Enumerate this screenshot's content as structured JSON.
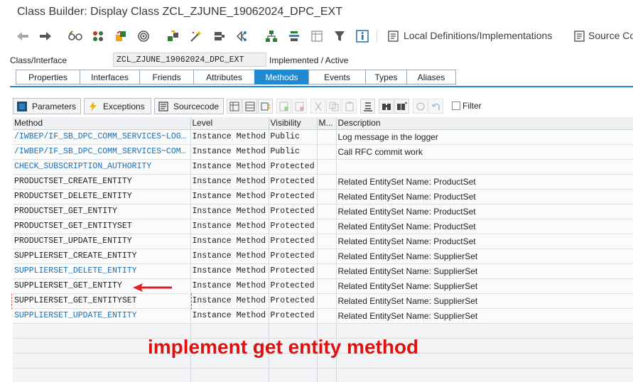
{
  "window": {
    "title": "Class Builder: Display Class ZCL_ZJUNE_19062024_DPC_EXT"
  },
  "toolbar": {
    "local_definitions_label": "Local Definitions/Implementations",
    "source_code_label": "Source Co"
  },
  "header": {
    "class_label": "Class/Interface",
    "class_value": "ZCL_ZJUNE_19062024_DPC_EXT",
    "status": "Implemented / Active"
  },
  "tabs": [
    "Properties",
    "Interfaces",
    "Friends",
    "Attributes",
    "Methods",
    "Events",
    "Types",
    "Aliases"
  ],
  "active_tab": "Methods",
  "method_toolbar": {
    "parameters_label": "Parameters",
    "exceptions_label": "Exceptions",
    "sourcecode_label": "Sourcecode",
    "filter_label": "Filter"
  },
  "columns": [
    "Method",
    "Level",
    "Visibility",
    "M...",
    "Description"
  ],
  "rows": [
    {
      "method": "/IWBEP/IF_SB_DPC_COMM_SERVICES~LOG_MESSAGE",
      "level": "Instance Method",
      "visibility": "Public",
      "m": "",
      "description": "Log message in the logger",
      "style": "link"
    },
    {
      "method": "/IWBEP/IF_SB_DPC_COMM_SERVICES~COMMIT_WORK",
      "level": "Instance Method",
      "visibility": "Public",
      "m": "",
      "description": "Call RFC commit work",
      "style": "link"
    },
    {
      "method": "CHECK_SUBSCRIPTION_AUTHORITY",
      "level": "Instance Method",
      "visibility": "Protected",
      "m": "",
      "description": "",
      "style": "link"
    },
    {
      "method": "PRODUCTSET_CREATE_ENTITY",
      "level": "Instance Method",
      "visibility": "Protected",
      "m": "",
      "description": "Related EntitySet Name: ProductSet",
      "style": "plain"
    },
    {
      "method": "PRODUCTSET_DELETE_ENTITY",
      "level": "Instance Method",
      "visibility": "Protected",
      "m": "",
      "description": "Related EntitySet Name: ProductSet",
      "style": "plain"
    },
    {
      "method": "PRODUCTSET_GET_ENTITY",
      "level": "Instance Method",
      "visibility": "Protected",
      "m": "",
      "description": "Related EntitySet Name: ProductSet",
      "style": "plain"
    },
    {
      "method": "PRODUCTSET_GET_ENTITYSET",
      "level": "Instance Method",
      "visibility": "Protected",
      "m": "",
      "description": "Related EntitySet Name: ProductSet",
      "style": "plain"
    },
    {
      "method": "PRODUCTSET_UPDATE_ENTITY",
      "level": "Instance Method",
      "visibility": "Protected",
      "m": "",
      "description": "Related EntitySet Name: ProductSet",
      "style": "plain"
    },
    {
      "method": "SUPPLIERSET_CREATE_ENTITY",
      "level": "Instance Method",
      "visibility": "Protected",
      "m": "",
      "description": "Related EntitySet Name: SupplierSet",
      "style": "plain"
    },
    {
      "method": "SUPPLIERSET_DELETE_ENTITY",
      "level": "Instance Method",
      "visibility": "Protected",
      "m": "",
      "description": "Related EntitySet Name: SupplierSet",
      "style": "link"
    },
    {
      "method": "SUPPLIERSET_GET_ENTITY",
      "level": "Instance Method",
      "visibility": "Protected",
      "m": "",
      "description": "Related EntitySet Name: SupplierSet",
      "style": "plain"
    },
    {
      "method": "SUPPLIERSET_GET_ENTITYSET",
      "level": "Instance Method",
      "visibility": "Protected",
      "m": "",
      "description": "Related EntitySet Name: SupplierSet",
      "style": "plain"
    },
    {
      "method": "SUPPLIERSET_UPDATE_ENTITY",
      "level": "Instance Method",
      "visibility": "Protected",
      "m": "",
      "description": "Related EntitySet Name: SupplierSet",
      "style": "link"
    }
  ],
  "annotation": "implement get entity method",
  "colors": {
    "accent": "#1f8ad1",
    "link": "#1b6fb8",
    "annotation": "#e01010"
  },
  "icons": [
    "back-arrow-icon",
    "forward-arrow-icon",
    "glasses-icon",
    "object-list-icon",
    "hierarchy-icon",
    "display-icon",
    "activate-icon",
    "wand-icon",
    "test-icon",
    "where-used-icon",
    "structure-icon",
    "indent-icon",
    "table-icon",
    "filter-icon",
    "info-icon",
    "local-defs-icon",
    "source-code-icon"
  ]
}
